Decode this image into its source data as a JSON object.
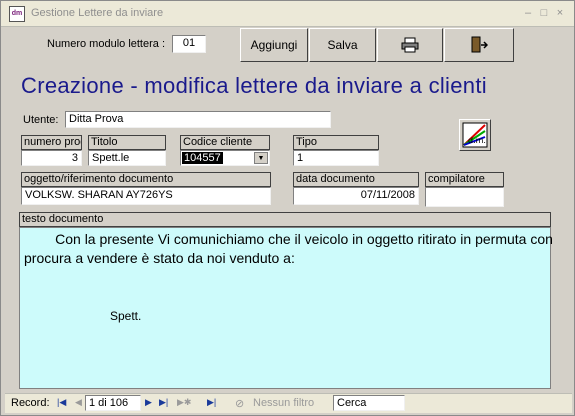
{
  "window": {
    "title": "Gestione Lettere da inviare",
    "app_icon_text": "dm",
    "controls": {
      "minimize": "–",
      "restore": "□",
      "close": "×"
    }
  },
  "toolbar": {
    "modulo_label": "Numero modulo lettera :",
    "modulo_value": "01",
    "add_label": "Aggiungi",
    "save_label": "Salva",
    "print_icon": "printer-icon",
    "exit_icon": "exit-door-icon"
  },
  "heading": "Creazione - modifica lettere da inviare a clienti",
  "utente": {
    "label": "Utente:",
    "value": "Ditta Prova"
  },
  "fields": {
    "numero_prog": {
      "label": "numero prog",
      "value": "3"
    },
    "titolo": {
      "label": "Titolo",
      "value": "Spett.le"
    },
    "codice_cliente": {
      "label": "Codice cliente",
      "value": "104557"
    },
    "tipo": {
      "label": "Tipo",
      "value": "1"
    },
    "oggetto": {
      "label": "oggetto/riferimento documento",
      "value": "VOLKSW. SHARAN AY726YS"
    },
    "data_documento": {
      "label": "data documento",
      "value": "07/11/2008"
    },
    "compilatore": {
      "label": "compilatore",
      "value": ""
    }
  },
  "testo": {
    "label": "testo documento",
    "line1": "        Con la presente Vi comunichiamo che il veicolo in oggetto ritirato in permuta con",
    "line2": "procura a vendere è stato da noi venduto   a:",
    "line3": "Spett."
  },
  "navigation": {
    "record_label": "Record:",
    "record_position": "1 di 106",
    "filter_label": "Nessun filtro",
    "search_label": "Cerca"
  }
}
